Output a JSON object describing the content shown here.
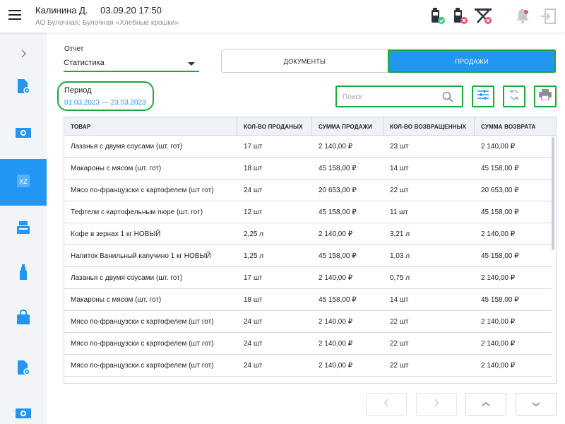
{
  "header": {
    "user_name": "Калинина Д.",
    "datetime": "03.09.20 17:50",
    "organization": "АО Булочная: Булочная «Хлебные крошки»",
    "icons": [
      "device-ok-icon",
      "device-error-icon",
      "network-error-icon",
      "bell-icon",
      "logout-icon"
    ]
  },
  "sidebar": {
    "items": [
      {
        "icon": "chevron-right-icon"
      },
      {
        "icon": "document-settings-icon"
      },
      {
        "icon": "cash-icon"
      },
      {
        "icon": "xz-report-icon",
        "label": "XZ",
        "active": true
      },
      {
        "icon": "cash-register-icon"
      },
      {
        "icon": "bottle-icon"
      },
      {
        "icon": "shopping-bag-icon"
      },
      {
        "icon": "document-settings-icon"
      },
      {
        "icon": "cash-icon"
      }
    ]
  },
  "report": {
    "label": "Отчет",
    "value": "Статистика"
  },
  "tabs": [
    {
      "label": "ДОКУМЕНТЫ",
      "active": false
    },
    {
      "label": "ПРОДАЖИ",
      "active": true
    }
  ],
  "period": {
    "title": "Период",
    "value": "01.03.2023 — 23.03.2023"
  },
  "search": {
    "placeholder": "Поиск"
  },
  "table": {
    "columns": [
      "ТОВАР",
      "КОЛ-ВО ПРОДАНЫХ",
      "СУММА ПРОДАЖИ",
      "КОЛ-ВО ВОЗВРАЩЕННЫХ",
      "СУММА ВОЗВРАТА"
    ],
    "rows": [
      [
        "Лазанья с двумя соусами (шт. гот)",
        "17 шт",
        "2 140,00 ₽",
        "23 шт",
        "2 140,00 ₽"
      ],
      [
        "Макароны с мясом (шт. гот)",
        "18 шт",
        "45 158,00 ₽",
        "14 шт",
        "45 158,00 ₽"
      ],
      [
        "Мясо по-французски с картофелем (шт гот)",
        "24 шт",
        "20 653,00 ₽",
        "22 шт",
        "20 653,00 ₽"
      ],
      [
        "Тефтели с картофельным пюре (шт. гот)",
        "12 шт",
        "45 158,00 ₽",
        "11 шт",
        "45 158,00 ₽"
      ],
      [
        "Кофе в зернах 1 кг НОВЫЙ",
        "2,25 л",
        "2 140,00 ₽",
        "3,21 л",
        "2 140,00 ₽"
      ],
      [
        "Напиток Ванильный капучино 1 кг НОВЫЙ",
        "1,25 л",
        "45 158,00 ₽",
        "1,03 л",
        "45 158,00 ₽"
      ],
      [
        "Лазанья с двумя соусами (шт. гот)",
        "17 шт",
        "2 140,00 ₽",
        "0,75 л",
        "2 140,00 ₽"
      ],
      [
        "Макароны с мясом (шт. гот)",
        "18 шт",
        "45 158,00 ₽",
        "14 шт",
        "45 158,00 ₽"
      ],
      [
        "Мясо по-французски с картофелем (шт гот)",
        "24 шт",
        "2 140,00 ₽",
        "22 шт",
        "2 140,00 ₽"
      ],
      [
        "Мясо по-французски с картофелем (шт гот)",
        "24 шт",
        "2 140,00 ₽",
        "22 шт",
        "2 140,00 ₽"
      ],
      [
        "Мясо по-французски с картофелем (шт гот)",
        "24 шт",
        "2 140,00 ₽",
        "22 шт",
        "2 140,00 ₽"
      ]
    ]
  },
  "pagination": [
    "chevron-left-icon",
    "chevron-right-icon",
    "chevron-up-icon",
    "chevron-down-icon"
  ],
  "colors": {
    "accent": "#2196f3",
    "highlight": "#1aaa3c",
    "error": "#f0506e",
    "ok": "#2ecc71"
  }
}
